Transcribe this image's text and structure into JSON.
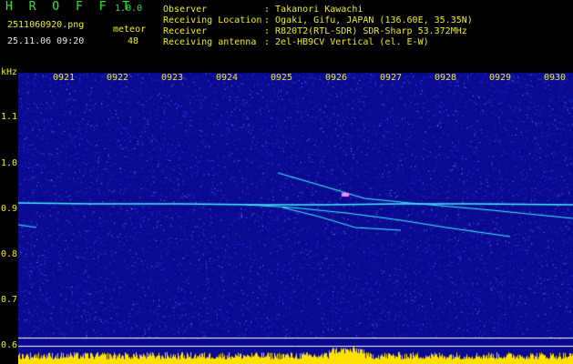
{
  "header": {
    "app_name": "H R O F F T",
    "version": "1.0.0",
    "filename": "2511060920.png",
    "event_label": "meteor",
    "datetime": "25.11.06 09:20",
    "meteor_count": "48",
    "info_labels": [
      "Observer",
      "Receiving Location",
      "Receiver",
      "Receiving antenna"
    ],
    "info_values": [
      ": Takanori Kawachi",
      ": Ogaki, Gifu, JAPAN (136.60E, 35.35N)",
      ": R820T2(RTL-SDR) SDR-Sharp 53.372MHz",
      ": 2el-HB9CV Vertical (el. E-W)"
    ]
  },
  "spectrogram": {
    "y_unit": "kHz",
    "y_ticks": [
      "1.1",
      "1.0",
      "0.9",
      "0.8",
      "0.7",
      "0.6"
    ],
    "time_ticks": [
      "0921",
      "0922",
      "0923",
      "0924",
      "0925",
      "0926",
      "0927",
      "0928",
      "0929",
      "0930"
    ],
    "colors": {
      "background": "#0a0a90",
      "noise": "#3a50ff",
      "trace": "#40f0ff",
      "hot": "#ff80ff",
      "level": "#ffe000"
    }
  }
}
